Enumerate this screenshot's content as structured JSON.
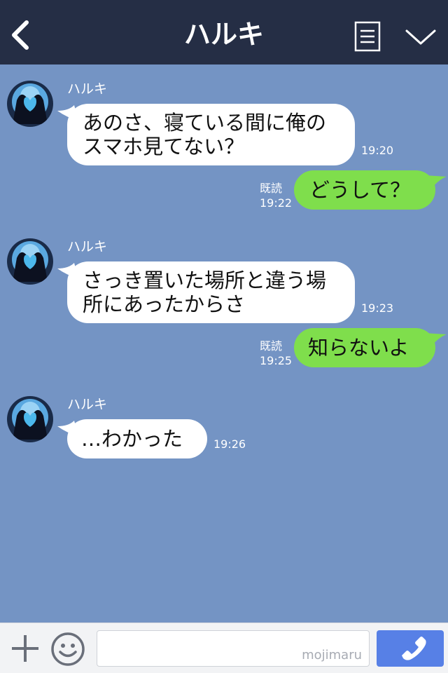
{
  "header": {
    "title": "ハルキ",
    "icons": [
      "chevron-left-icon",
      "notes-icon",
      "chevron-down-icon"
    ]
  },
  "messages": [
    {
      "sender": "ハルキ",
      "text_lines": [
        "あのさ、寝ている間に俺の",
        "スマホ見てない？"
      ],
      "time": "19:20",
      "direction": "incoming"
    },
    {
      "text_lines": [
        "どうして？"
      ],
      "time": "19:22",
      "read": "既読",
      "direction": "outgoing"
    },
    {
      "sender": "ハルキ",
      "text_lines": [
        "さっき置いた場所と違う場",
        "所にあったからさ"
      ],
      "time": "19:23",
      "direction": "incoming"
    },
    {
      "text_lines": [
        "知らないよ"
      ],
      "time": "19:25",
      "read": "既読",
      "direction": "outgoing"
    },
    {
      "sender": "ハルキ",
      "text_lines": [
        "…わかった"
      ],
      "time": "19:26",
      "direction": "incoming"
    }
  ],
  "footer": {
    "watermark": "mojimaru",
    "icons": [
      "plus-icon",
      "smiley-icon",
      "phone-icon"
    ]
  },
  "colors": {
    "header_bg": "#252e45",
    "chat_bg": "#7494c4",
    "incoming_bubble": "#ffffff",
    "outgoing_bubble": "#7fde4c",
    "call_button": "#5780e6"
  }
}
